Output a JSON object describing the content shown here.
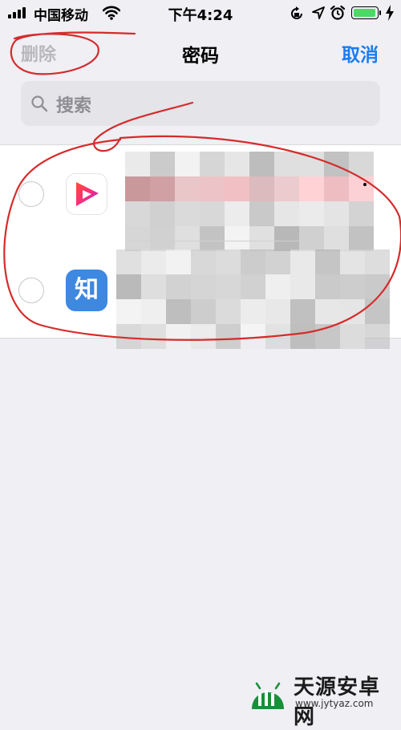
{
  "status_bar": {
    "carrier": "中国移动",
    "time": "下午4:24",
    "battery_level": 1.0,
    "icons": [
      "signal-icon",
      "wifi-icon",
      "orientation-lock-icon",
      "location-icon",
      "alarm-icon",
      "battery-icon",
      "charging-icon"
    ]
  },
  "nav": {
    "delete_label": "删除",
    "title": "密码",
    "cancel_label": "取消"
  },
  "search": {
    "placeholder": "搜索"
  },
  "list": {
    "items": [
      {
        "icon": "video-play-app-icon",
        "selected": false
      },
      {
        "icon": "zhihu-app-icon",
        "icon_text": "知",
        "selected": false
      }
    ]
  },
  "watermark": {
    "name": "天源安卓网",
    "url": "www.jytyaz.com"
  },
  "colors": {
    "accent": "#1a7cf5",
    "disabled": "#b8b8bd",
    "annotation": "#d62b2b",
    "zhihu_blue": "#3d88e0",
    "battery": "#4cd964"
  }
}
